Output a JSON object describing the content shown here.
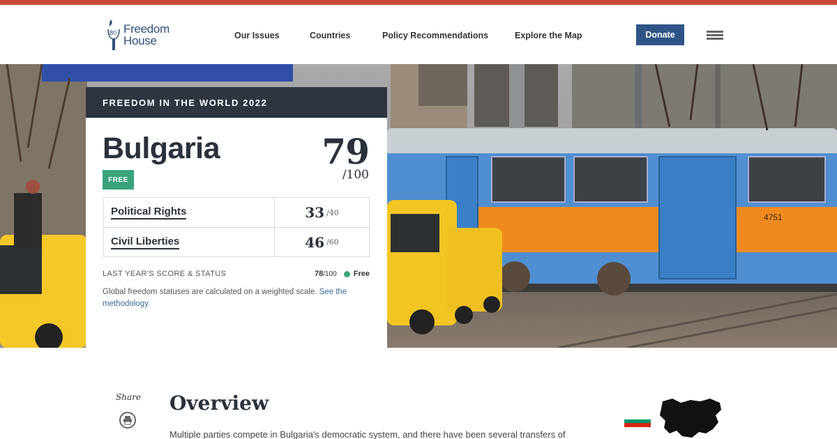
{
  "header": {
    "logo": {
      "line1": "Freedom",
      "line2": "House"
    },
    "nav": [
      "Our Issues",
      "Countries",
      "Policy Recommendations",
      "Explore the Map"
    ],
    "donate": "Donate"
  },
  "card": {
    "eyebrow": "FREEDOM IN THE WORLD 2022",
    "country": "Bulgaria",
    "status": "FREE",
    "total_score": "79",
    "total_max": "/100",
    "rows": [
      {
        "label": "Political Rights",
        "score": "33",
        "max": "/40"
      },
      {
        "label": "Civil Liberties",
        "score": "46",
        "max": "/60"
      }
    ],
    "last_year_label": "LAST YEAR'S SCORE & STATUS",
    "last_year_score": "78",
    "last_year_max": "/100",
    "last_year_status": "Free",
    "note_text": "Global freedom statuses are calculated on a weighted scale. ",
    "note_link": "See the methodology."
  },
  "content": {
    "share": "Share",
    "overview_title": "Overview",
    "overview_text": "Multiple parties compete in Bulgaria's democratic system, and there have been several transfers of"
  },
  "colors": {
    "accent_strip": "#c84a35",
    "brand_blue": "#2f5586",
    "free_green": "#3aa37b",
    "card_dark": "#2e3541"
  },
  "icons": {
    "menu": "hamburger-icon",
    "print": "print-icon"
  }
}
